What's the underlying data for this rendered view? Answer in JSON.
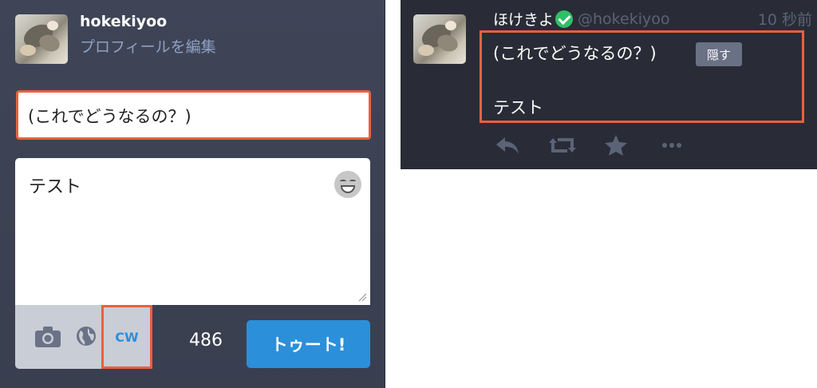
{
  "compose": {
    "username": "hokekiyoo",
    "edit_profile": "プロフィールを編集",
    "content_warning": "(これでどうなるの？)",
    "toot_text": "テスト",
    "cw_label": "CW",
    "char_count": "486",
    "toot_button": "トゥート!"
  },
  "status": {
    "display_name": "ほけきよ",
    "acct": "@hokekiyoo",
    "timestamp": "10 秒前",
    "spoiler": "(これでどうなるの？)",
    "hide_button": "隠す",
    "text": "テスト"
  },
  "icons": [
    "emoji-icon",
    "camera-icon",
    "globe-icon",
    "verified-icon",
    "reply-icon",
    "boost-icon",
    "favourite-icon",
    "more-icon"
  ],
  "colors": {
    "compose_background": "#3f4557",
    "status_background": "#292c36",
    "highlight_border": "#e8613c",
    "accent_blue": "#2b90d9",
    "verified_green": "#2fbf67"
  }
}
